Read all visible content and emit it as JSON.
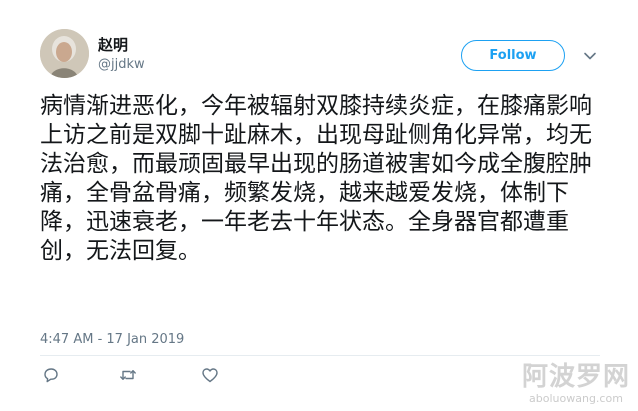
{
  "tweet": {
    "author": {
      "display_name": "赵明",
      "screen_name": "@jjdkw"
    },
    "follow_label": "Follow",
    "text": "病情渐进恶化，今年被辐射双膝持续炎症，在膝痛影响上访之前是双脚十趾麻木，出现母趾侧角化异常，均无法治愈，而最顽固最早出现的肠道被害如今成全腹腔肿痛，全骨盆骨痛，频繁发烧，越来越爱发烧，体制下降，迅速衰老，一年老去十年状态。全身器官都遭重创，无法回复。",
    "timestamp": "4:47 AM - 17 Jan 2019",
    "actions": [
      "reply-icon",
      "retweet-icon",
      "like-icon"
    ]
  },
  "watermark": {
    "main": "阿波罗网",
    "sub": "aboluowang.com"
  },
  "colors": {
    "accent": "#1da1f2",
    "text": "#14171a",
    "muted": "#657786"
  }
}
